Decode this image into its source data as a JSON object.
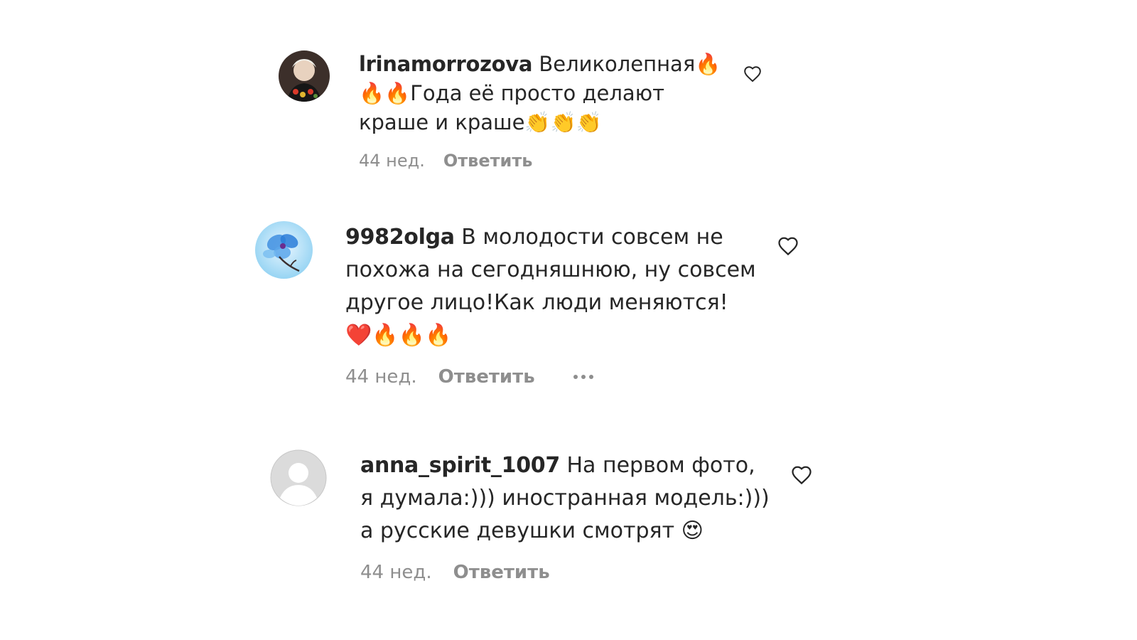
{
  "comments": [
    {
      "username": "lrinamorrozova",
      "text": "Великолепная🔥🔥🔥Года её просто делают краше и краше👏👏👏",
      "time": "44 нед.",
      "reply_label": "Ответить",
      "avatar_icon": "user-photo-avatar",
      "like_icon": "heart-outline-icon"
    },
    {
      "username": "9982olga",
      "text": "В молодости совсем не похожа на сегодняшнюю, ну совсем другое лицо!Как люди меняются! ❤️🔥🔥🔥",
      "time": "44 нед.",
      "reply_label": "Ответить",
      "avatar_icon": "blue-flower-avatar",
      "like_icon": "heart-outline-icon",
      "more_icon": "more-options-icon"
    },
    {
      "username": "anna_spirit_1007",
      "text": "На первом фото, я думала:))) иностранная модель:))) а русские девушки смотрят 😍",
      "time": "44 нед.",
      "reply_label": "Ответить",
      "avatar_icon": "default-user-avatar",
      "like_icon": "heart-outline-icon"
    }
  ],
  "colors": {
    "text": "#262626",
    "secondary_text": "#8e8e8e",
    "avatar_placeholder": "#dbdbdb"
  }
}
